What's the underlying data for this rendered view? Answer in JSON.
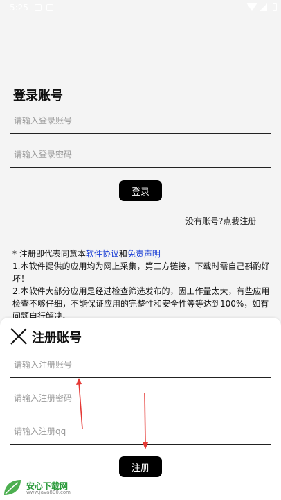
{
  "status_bar": {
    "time": "5:25"
  },
  "login": {
    "title": "登录账号",
    "account_placeholder": "请输入登录账号",
    "password_placeholder": "请输入登录密码",
    "login_button": "登录",
    "register_link": "没有账号?点我注册"
  },
  "agreement": {
    "prefix": "* 注册即代表同意本",
    "software_agreement": "软件协议",
    "and": "和",
    "disclaimer": "免责声明",
    "line1": "1.本软件提供的应用均为网上采集，第三方链接，下载时需自己斟酌好坏！",
    "line2": "2.本软件大部分应用是经过检查筛选发布的，因工作量太大，有些应用检查不够仔细，不能保证应用的完整性和安全性等等达到100%，如有问题自行解决。"
  },
  "register_sheet": {
    "title": "注册账号",
    "account_placeholder": "请输入注册账号",
    "password_placeholder": "请输入注册密码",
    "qq_placeholder": "请输入注册qq",
    "register_button": "注册"
  },
  "watermark": {
    "name": "安心下载网",
    "url": "www.java800.com"
  },
  "colors": {
    "accent": "#000000",
    "link": "#1a3fd6",
    "annotation_arrow": "#e53935"
  }
}
